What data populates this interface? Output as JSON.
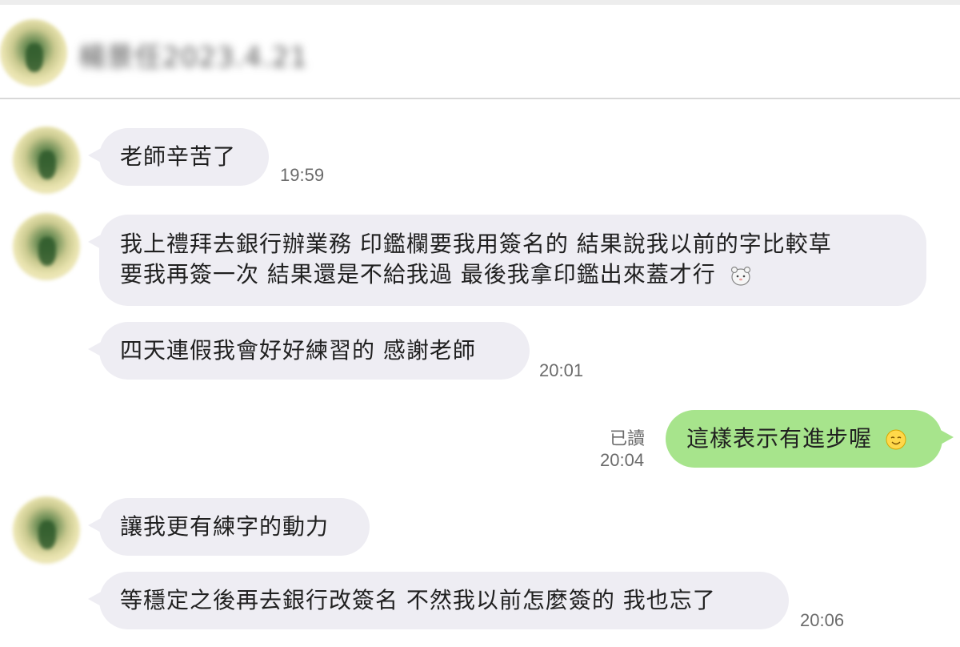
{
  "header": {
    "contact_name": "楊景任2023.4.21"
  },
  "messages": [
    {
      "side": "in",
      "text": "老師辛苦了",
      "time": "19:59"
    },
    {
      "side": "in",
      "line1": "我上禮拜去銀行辦業務 印鑑欄要我用簽名的 結果說我以前的字比較草",
      "line2": "要我再簽一次 結果還是不給我過 最後我拿印鑑出來蓋才行",
      "sticker": "bear-sticker-icon"
    },
    {
      "side": "in",
      "text": "四天連假我會好好練習的 感謝老師",
      "time": "20:01"
    },
    {
      "side": "out",
      "text": "這樣表示有進步喔",
      "emoji": "smile-emoji-icon",
      "read": "已讀",
      "time": "20:04"
    },
    {
      "side": "in",
      "text": "讓我更有練字的動力"
    },
    {
      "side": "in",
      "text": "等穩定之後再去銀行改簽名 不然我以前怎麼簽的 我也忘了",
      "time": "20:06"
    }
  ],
  "colors": {
    "incoming_bubble": "#eeedf3",
    "outgoing_bubble": "#a7e48c",
    "timestamp": "#6b6b6b"
  }
}
